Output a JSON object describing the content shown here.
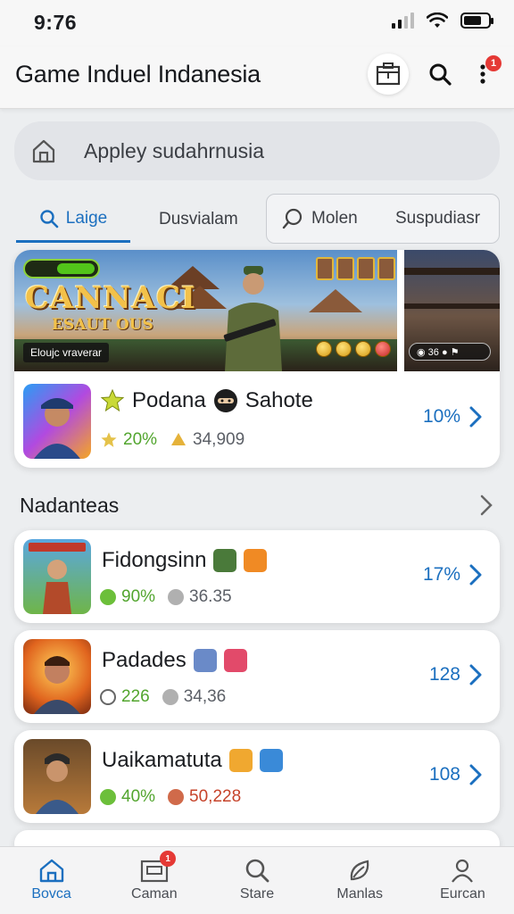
{
  "status_bar": {
    "time": "9:76"
  },
  "header": {
    "title": "Game Induel Indanesia",
    "notification_count": "1"
  },
  "search": {
    "placeholder": "Appley sudahrnusia"
  },
  "tabs": [
    {
      "label": "Laige",
      "icon": "search-icon",
      "active": true
    },
    {
      "label": "Dusvialam",
      "active": false
    },
    {
      "label": "Molen",
      "icon": "search-icon",
      "active": false
    },
    {
      "label": "Suspudiasr",
      "active": false
    }
  ],
  "featured": {
    "banner_title": "CANNACI",
    "banner_subtitle": "ESAUT OUS",
    "banner_tag": "Eloujc vraverar",
    "side_banner_stat": "36",
    "title": "Podana",
    "title_extra": "Sahote",
    "stat_percent": "20%",
    "stat_count": "34,909",
    "right_value": "10%"
  },
  "section": {
    "title": "Nadanteas"
  },
  "games": [
    {
      "title": "Fidongsinn",
      "percent": "90%",
      "count": "36.35",
      "right_value": "17%",
      "count_color": "#5b5f66"
    },
    {
      "title": "Padades",
      "percent": "226",
      "count": "34,36",
      "right_value": "128",
      "count_color": "#5b5f66"
    },
    {
      "title": "Uaikamatuta",
      "percent": "40%",
      "count": "50,228",
      "right_value": "108",
      "count_color": "#c6432a"
    }
  ],
  "bottom_nav": [
    {
      "label": "Bovca",
      "icon": "home-icon",
      "active": true
    },
    {
      "label": "Caman",
      "icon": "store-icon",
      "active": false,
      "badge": "1"
    },
    {
      "label": "Stare",
      "icon": "search-icon",
      "active": false
    },
    {
      "label": "Manlas",
      "icon": "leaf-icon",
      "active": false
    },
    {
      "label": "Eurcan",
      "icon": "profile-icon",
      "active": false
    }
  ],
  "colors": {
    "accent": "#1b6fbf",
    "green": "#52a52e",
    "badge_red": "#e53935"
  }
}
